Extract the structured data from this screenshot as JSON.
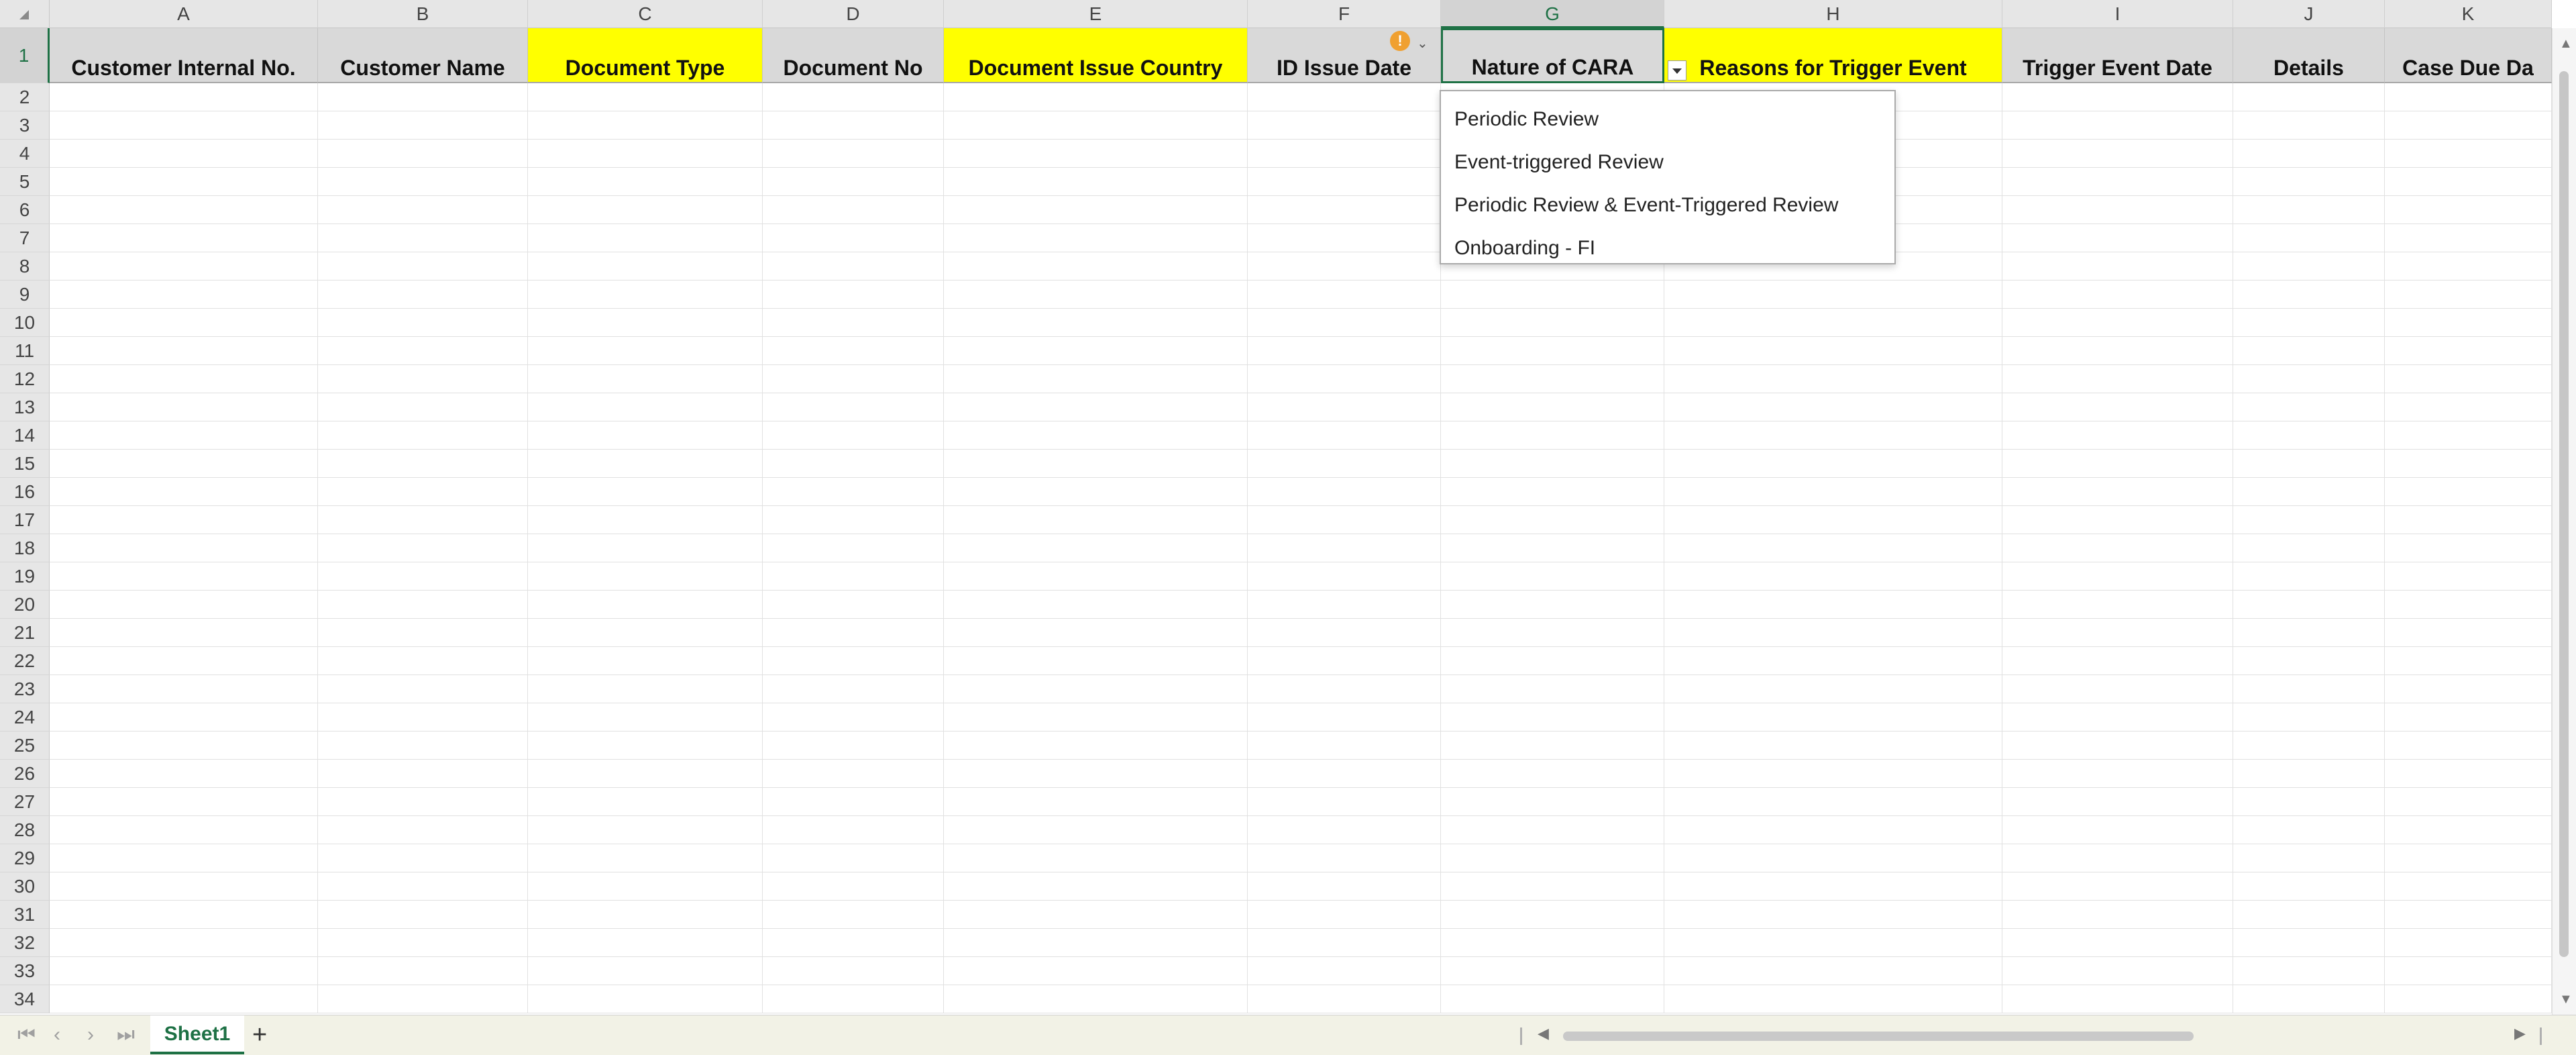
{
  "columns": [
    "A",
    "B",
    "C",
    "D",
    "E",
    "F",
    "G",
    "H",
    "I",
    "J",
    "K"
  ],
  "selected_column": "G",
  "row_numbers": [
    "1",
    "2",
    "3",
    "4",
    "5",
    "6",
    "7",
    "8",
    "9",
    "10",
    "11",
    "12",
    "13",
    "14",
    "15",
    "16",
    "17",
    "18",
    "19",
    "20",
    "21",
    "22",
    "23",
    "24",
    "25",
    "26",
    "27",
    "28",
    "29",
    "30",
    "31",
    "32",
    "33",
    "34"
  ],
  "header_row": [
    {
      "col": "A",
      "label": "Customer Internal No.",
      "highlight": false
    },
    {
      "col": "B",
      "label": "Customer Name",
      "highlight": false
    },
    {
      "col": "C",
      "label": "Document Type",
      "highlight": true
    },
    {
      "col": "D",
      "label": "Document No",
      "highlight": false
    },
    {
      "col": "E",
      "label": "Document Issue Country",
      "highlight": true
    },
    {
      "col": "F",
      "label": "ID Issue Date",
      "highlight": false
    },
    {
      "col": "G",
      "label": "Nature of CARA",
      "highlight": false
    },
    {
      "col": "H",
      "label": "Reasons for Trigger Event",
      "highlight": true
    },
    {
      "col": "I",
      "label": "Trigger Event Date",
      "highlight": false
    },
    {
      "col": "J",
      "label": "Details",
      "highlight": false
    },
    {
      "col": "K",
      "label": "Case Due Da",
      "highlight": false
    }
  ],
  "active_cell": "G1",
  "dropdown": {
    "options": [
      "Periodic Review",
      "Event-triggered Review",
      "Periodic Review & Event-Triggered Review",
      "Onboarding - FI"
    ]
  },
  "warning_icon": "exclamation-icon",
  "sheet_tabs": [
    {
      "label": "Sheet1",
      "active": true
    }
  ],
  "add_sheet_label": "+",
  "colors": {
    "header_gray": "#d9d9d9",
    "highlight_yellow": "#ffff00",
    "accent_green": "#1e7145"
  }
}
